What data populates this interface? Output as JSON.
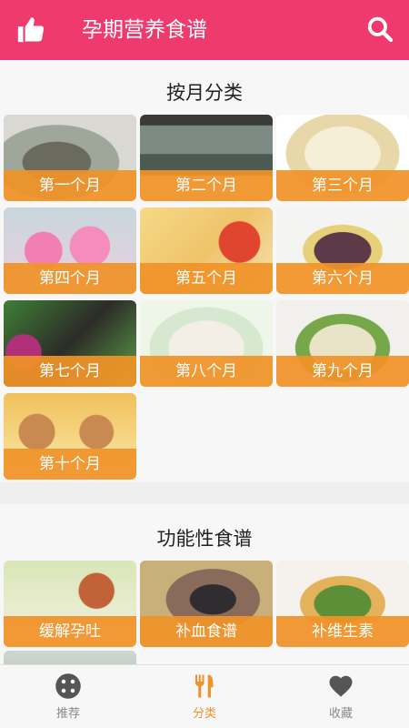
{
  "header": {
    "title": "孕期营养食谱",
    "like_icon": "thumbs-up-icon",
    "search_icon": "search-icon",
    "background": "#ee3a6c"
  },
  "monthly": {
    "title": "按月分类",
    "items": [
      {
        "label": "第一个月"
      },
      {
        "label": "第二个月"
      },
      {
        "label": "第三个月"
      },
      {
        "label": "第四个月"
      },
      {
        "label": "第五个月"
      },
      {
        "label": "第六个月"
      },
      {
        "label": "第七个月"
      },
      {
        "label": "第八个月"
      },
      {
        "label": "第九个月"
      },
      {
        "label": "第十个月"
      }
    ]
  },
  "functional": {
    "title": "功能性食谱",
    "items": [
      {
        "label": "缓解孕吐"
      },
      {
        "label": "补血食谱"
      },
      {
        "label": "补维生素"
      }
    ]
  },
  "tabbar": {
    "items": [
      {
        "label": "推荐",
        "icon": "dice-icon",
        "active": false
      },
      {
        "label": "分类",
        "icon": "fork-knife-icon",
        "active": true
      },
      {
        "label": "收藏",
        "icon": "heart-icon",
        "active": false
      }
    ],
    "accent": "#f0922a"
  }
}
